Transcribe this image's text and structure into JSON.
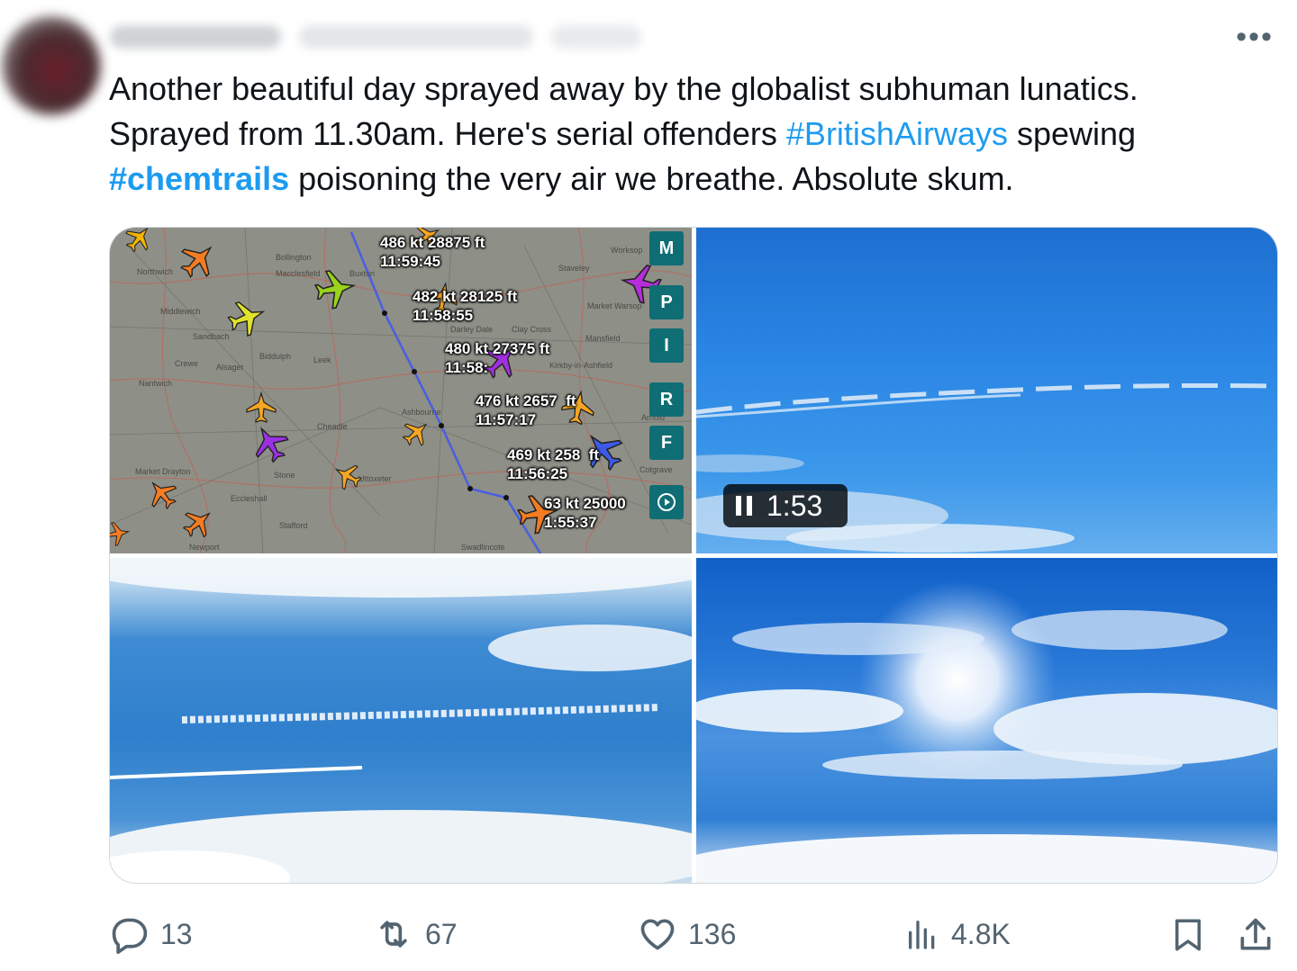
{
  "tweet": {
    "text_lines": [
      [
        {
          "t": "Another beautiful day sprayed away by the globalist subhuman lunatics."
        }
      ],
      [
        {
          "t": "Sprayed from 11.30am. Here's serial offenders "
        },
        {
          "t": "#BritishAirways",
          "hashtag": true
        },
        {
          "t": " spewing"
        }
      ],
      [
        {
          "t": "#chemtrails",
          "hashtag": true,
          "bold": true
        },
        {
          "t": " poisoning the very air we breathe. Absolute skum."
        }
      ]
    ],
    "more_icon": "more-horizontal-icon"
  },
  "media": {
    "flight_map": {
      "labels": [
        "486 kt 28875 ft\n11:59:45",
        "482 kt 28125 ft\n11:58:55",
        "480 kt 27375 ft\n11:58:",
        "476 kt 2657  ft\n11:57:17",
        "469 kt 258  ft\n11:56:25",
        "63 kt 25000\n1:55:37"
      ],
      "side_buttons": [
        "M",
        "P",
        "I",
        "R",
        "F"
      ],
      "towns": [
        "Northwich",
        "Middlewich",
        "Sandbach",
        "Crewe",
        "Alsager",
        "Nantwich",
        "Market Drayton",
        "Eccleshall",
        "Stafford",
        "Stone",
        "Uttoxeter",
        "Ashbourne",
        "Leek",
        "Macclesfield",
        "Buxton",
        "Cheadle",
        "Newport",
        "Swadlincote",
        "Mansfield",
        "Worksop",
        "Arnold",
        "Cotgrave",
        "Bollington",
        "Biddulph",
        "Darley Dale",
        "Clay Cross",
        "Kirkby-in-Ashfield",
        "Staveley",
        "Market Warsop"
      ],
      "route_color": "#4a5fe0"
    },
    "video": {
      "time": "1:53",
      "pause_icon": "pause-icon"
    }
  },
  "actions": {
    "reply": {
      "icon": "reply-icon",
      "count": "13"
    },
    "retweet": {
      "icon": "retweet-icon",
      "count": "67"
    },
    "like": {
      "icon": "heart-icon",
      "count": "136"
    },
    "views": {
      "icon": "views-bar-chart-icon",
      "count": "4.8K"
    },
    "bookmark": {
      "icon": "bookmark-icon"
    },
    "share": {
      "icon": "share-icon"
    }
  },
  "colors": {
    "accent": "#1d9bf0",
    "muted": "#536471",
    "text": "#0f1419"
  }
}
